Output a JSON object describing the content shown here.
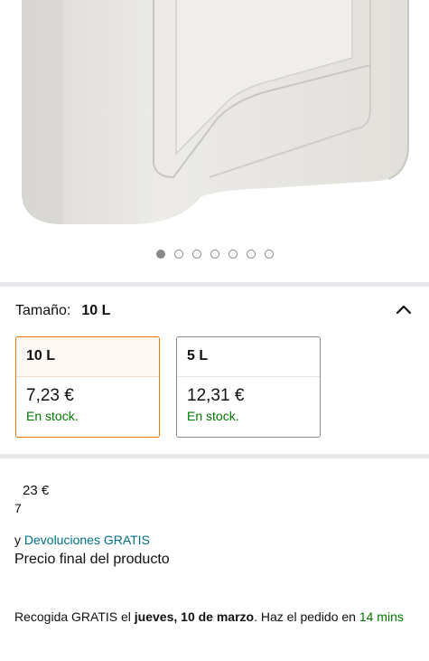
{
  "carousel": {
    "total": 7,
    "active_index": 0
  },
  "size_selector": {
    "label": "Tamaño:",
    "selected": "10 L",
    "options": [
      {
        "name": "10 L",
        "price": "7,23 €",
        "stock": "En stock.",
        "selected": true
      },
      {
        "name": "5 L",
        "price": "12,31 €",
        "stock": "En stock.",
        "selected": false
      }
    ]
  },
  "price": {
    "cents_part": "23 €",
    "whole_part": "7"
  },
  "returns": {
    "prefix": "y",
    "link": "Devoluciones GRATIS"
  },
  "final_price_note": "Precio final del producto",
  "delivery": {
    "prefix": "Recogida GRATIS el",
    "date": "jueves, 10 de marzo",
    "middle": ". Haz el pedido en",
    "countdown": "14 mins"
  },
  "colors": {
    "accent": "#e77600",
    "link": "#007185",
    "stock": "#007600"
  }
}
